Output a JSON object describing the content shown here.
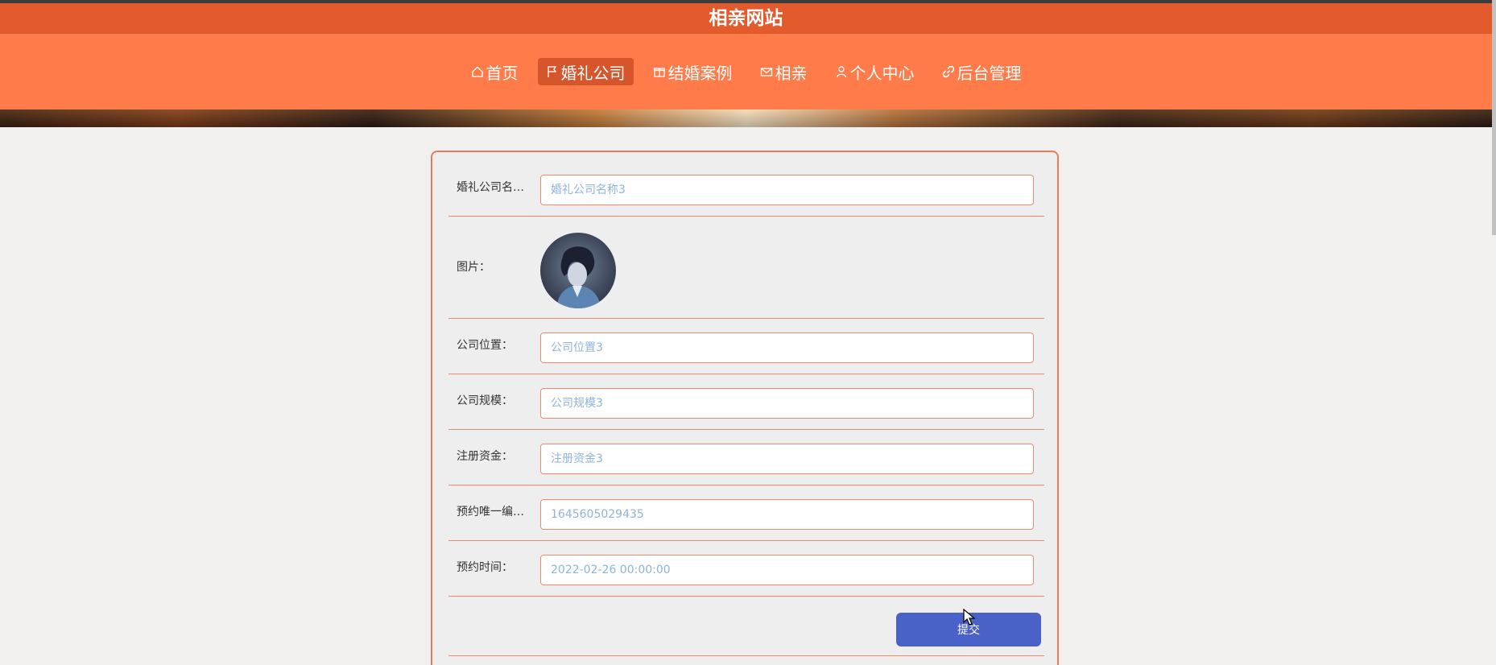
{
  "site": {
    "title": "相亲网站"
  },
  "nav": {
    "items": [
      {
        "label": "首页",
        "icon": "home-icon"
      },
      {
        "label": "婚礼公司",
        "icon": "flag-icon",
        "active": true
      },
      {
        "label": "结婚案例",
        "icon": "gift-icon"
      },
      {
        "label": "相亲",
        "icon": "mail-icon"
      },
      {
        "label": "个人中心",
        "icon": "user-icon"
      },
      {
        "label": "后台管理",
        "icon": "link-icon"
      }
    ]
  },
  "form": {
    "fields": {
      "company_name": {
        "label": "婚礼公司名称：",
        "value": "婚礼公司名称3"
      },
      "image": {
        "label": "图片："
      },
      "location": {
        "label": "公司位置：",
        "value": "公司位置3"
      },
      "scale": {
        "label": "公司规模：",
        "value": "公司规模3"
      },
      "capital": {
        "label": "注册资金：",
        "value": "注册资金3"
      },
      "booking_id": {
        "label": "预约唯一编号：",
        "value": "1645605029435"
      },
      "booking_time": {
        "label": "预约时间：",
        "value": "2022-02-26 00:00:00"
      }
    },
    "submit_label": "提交"
  },
  "colors": {
    "title_bar": "#e35a2c",
    "nav_bar": "#ff7b4a",
    "nav_active": "#d6562b",
    "border_accent": "#f07a55",
    "submit": "#4a61c7",
    "input_text": "#8fb3df"
  }
}
